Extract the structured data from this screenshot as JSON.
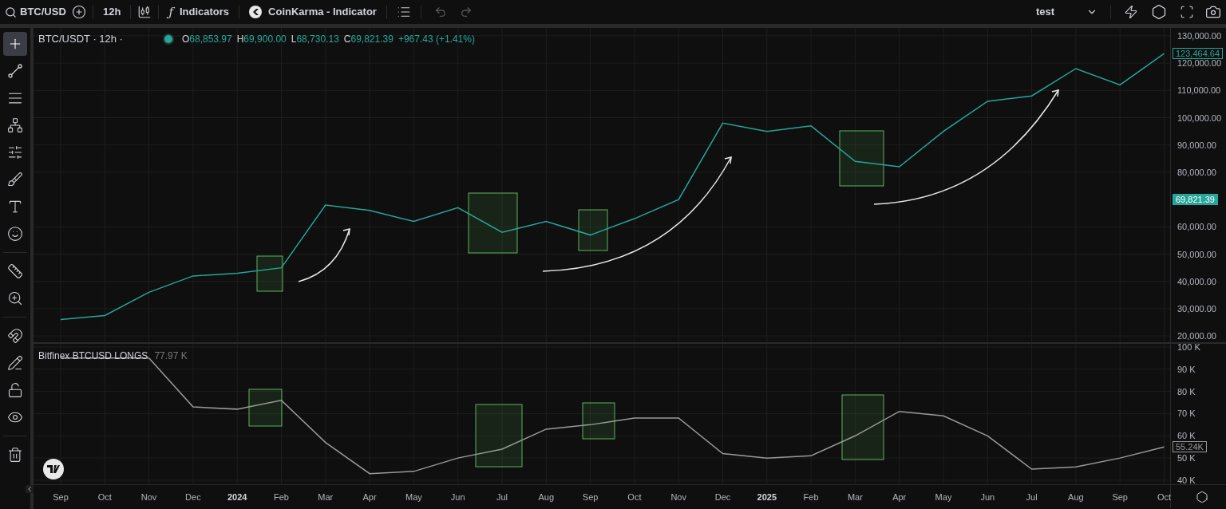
{
  "toolbar": {
    "symbol": "BTC/USD",
    "interval": "12h",
    "indicators_icon": "ƒ",
    "indicators": "Indicators",
    "script": "CoinKarma - Indicator",
    "layout": "test"
  },
  "legend": {
    "title": "BTC/USDT · 12h ·",
    "ohlc": [
      {
        "label": "O",
        "value": "68,853.97"
      },
      {
        "label": "H",
        "value": "69,900.00"
      },
      {
        "label": "L",
        "value": "68,730.13"
      },
      {
        "label": "C",
        "value": "69,821.39"
      }
    ],
    "change": "+967.43 (+1.41%)"
  },
  "tools": [
    {
      "kind": "crosshair",
      "selected": true
    },
    {
      "kind": "line",
      "selected": false
    },
    {
      "kind": "hlines",
      "selected": false
    },
    {
      "kind": "pattern",
      "selected": false
    },
    {
      "kind": "fib",
      "selected": false
    },
    {
      "kind": "brush",
      "selected": false
    },
    {
      "kind": "text",
      "selected": false
    },
    {
      "kind": "emoji",
      "selected": false
    },
    {
      "kind": "divider"
    },
    {
      "kind": "ruler",
      "selected": false
    },
    {
      "kind": "zoom",
      "selected": false
    },
    {
      "kind": "divider"
    },
    {
      "kind": "magnet",
      "selected": false
    },
    {
      "kind": "pencil-lock",
      "selected": false
    },
    {
      "kind": "lock",
      "selected": false
    },
    {
      "kind": "eye",
      "selected": false
    },
    {
      "kind": "divider"
    },
    {
      "kind": "trash",
      "selected": false
    }
  ],
  "price_chart": {
    "chart_data": {
      "type": "line",
      "grid": true,
      "series": [
        {
          "color": "#26a69a",
          "values": [
            26000,
            27500,
            36000,
            42000,
            43000,
            45000,
            68000,
            66000,
            62000,
            67000,
            58000,
            62000,
            57000,
            63000,
            70000,
            98000,
            95000,
            97000,
            84000,
            82000,
            95000,
            106000,
            108000,
            118000,
            112000,
            123500
          ]
        }
      ],
      "ylim": [
        17700,
        132900
      ],
      "yticks": [
        {
          "value": 130000,
          "label": "130,000.00"
        },
        {
          "value": 120000,
          "label": "120,000.00"
        },
        {
          "value": 110000,
          "label": "110,000.00"
        },
        {
          "value": 100000,
          "label": "100,000.00"
        },
        {
          "value": 90000,
          "label": "90,000.00"
        },
        {
          "value": 80000,
          "label": "80,000.00"
        },
        {
          "value": 60000,
          "label": "60,000.00"
        },
        {
          "value": 50000,
          "label": "50,000.00"
        },
        {
          "value": 40000,
          "label": "40,000.00"
        },
        {
          "value": 30000,
          "label": "30,000.00"
        },
        {
          "value": 20000,
          "label": "20,000.00"
        }
      ]
    },
    "markers": [
      {
        "label": "123,464.64",
        "kind": "last"
      },
      {
        "label": "69,821.39",
        "kind": "current"
      }
    ]
  },
  "indicator_chart": {
    "reading": "77.97 K",
    "chart_data": {
      "type": "line",
      "grid": true,
      "series": [
        {
          "name": "Bitfinex BTCUSD LONGS",
          "color": "#9a9a9a",
          "values": [
            95,
            95,
            95,
            73,
            72,
            76,
            57,
            43,
            44,
            50,
            54,
            63,
            65,
            68,
            68,
            52,
            50,
            51,
            60,
            71,
            69,
            60,
            45,
            46,
            50,
            55
          ]
        }
      ],
      "ylim": [
        38.2,
        101.4
      ],
      "yticks": [
        {
          "value": 100,
          "label": "100 K"
        },
        {
          "value": 90,
          "label": "90 K"
        },
        {
          "value": 80,
          "label": "80 K"
        },
        {
          "value": 70,
          "label": "70 K"
        },
        {
          "value": 60,
          "label": "60 K"
        },
        {
          "value": 50,
          "label": "50 K"
        },
        {
          "value": 40,
          "label": "40 K"
        }
      ]
    },
    "markers": [
      {
        "label": "55.24K",
        "kind": "last"
      }
    ]
  },
  "time_axis": [
    {
      "label": "Sep",
      "kind": "month"
    },
    {
      "label": "Oct",
      "kind": "month"
    },
    {
      "label": "Nov",
      "kind": "month"
    },
    {
      "label": "Dec",
      "kind": "month"
    },
    {
      "label": "2024",
      "kind": "year"
    },
    {
      "label": "Feb",
      "kind": "month"
    },
    {
      "label": "Mar",
      "kind": "month"
    },
    {
      "label": "Apr",
      "kind": "month"
    },
    {
      "label": "May",
      "kind": "month"
    },
    {
      "label": "Jun",
      "kind": "month"
    },
    {
      "label": "Jul",
      "kind": "month"
    },
    {
      "label": "Aug",
      "kind": "month"
    },
    {
      "label": "Sep",
      "kind": "month"
    },
    {
      "label": "Oct",
      "kind": "month"
    },
    {
      "label": "Nov",
      "kind": "month"
    },
    {
      "label": "Dec",
      "kind": "month"
    },
    {
      "label": "2025",
      "kind": "year"
    },
    {
      "label": "Feb",
      "kind": "month"
    },
    {
      "label": "Mar",
      "kind": "month"
    },
    {
      "label": "Apr",
      "kind": "month"
    },
    {
      "label": "May",
      "kind": "month"
    },
    {
      "label": "Jun",
      "kind": "month"
    },
    {
      "label": "Jul",
      "kind": "month"
    },
    {
      "label": "Aug",
      "kind": "month"
    },
    {
      "label": "Sep",
      "kind": "month"
    },
    {
      "label": "Oct",
      "kind": "month"
    }
  ]
}
